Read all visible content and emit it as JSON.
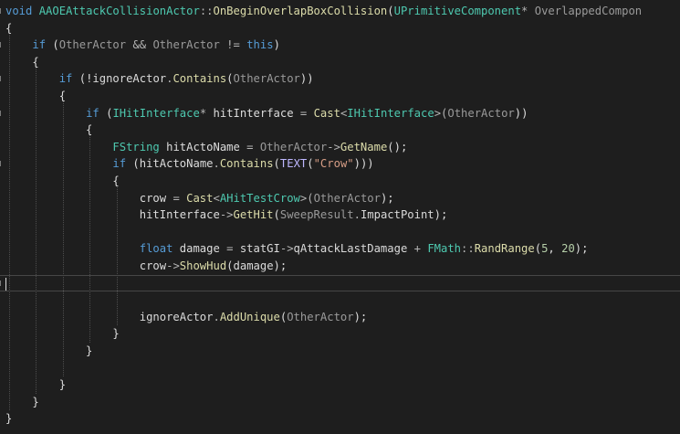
{
  "editor": {
    "language": "C++",
    "theme_colors": {
      "background": "#1e1e1e",
      "keyword": "#569cd6",
      "type": "#4ec9b0",
      "function": "#dcdcaa",
      "parameter": "#9a9a9a",
      "string": "#d69d85",
      "number": "#b5cea8",
      "macro": "#beb7ff",
      "plain": "#dcdcdc"
    },
    "cursor_line_index": 16,
    "lines": [
      {
        "tokens": [
          {
            "t": "void",
            "c": "kw"
          },
          {
            "t": " ",
            "c": "var"
          },
          {
            "t": "AAOEAttackCollisionActor",
            "c": "type"
          },
          {
            "t": "::",
            "c": "op"
          },
          {
            "t": "OnBeginOverlapBoxCollision",
            "c": "fn"
          },
          {
            "t": "(",
            "c": "var"
          },
          {
            "t": "UPrimitiveComponent",
            "c": "type"
          },
          {
            "t": "* ",
            "c": "op"
          },
          {
            "t": "OverlappedCompon",
            "c": "param"
          }
        ]
      },
      {
        "tokens": [
          {
            "t": "{",
            "c": "var"
          }
        ]
      },
      {
        "tokens": [
          {
            "t": "    ",
            "c": "var"
          },
          {
            "t": "if",
            "c": "kw"
          },
          {
            "t": " (",
            "c": "var"
          },
          {
            "t": "OtherActor",
            "c": "param"
          },
          {
            "t": " && ",
            "c": "op"
          },
          {
            "t": "OtherActor",
            "c": "param"
          },
          {
            "t": " != ",
            "c": "op"
          },
          {
            "t": "this",
            "c": "kw"
          },
          {
            "t": ")",
            "c": "var"
          }
        ]
      },
      {
        "tokens": [
          {
            "t": "    {",
            "c": "var"
          }
        ]
      },
      {
        "tokens": [
          {
            "t": "        ",
            "c": "var"
          },
          {
            "t": "if",
            "c": "kw"
          },
          {
            "t": " (!",
            "c": "var"
          },
          {
            "t": "ignoreActor",
            "c": "field"
          },
          {
            "t": ".",
            "c": "op"
          },
          {
            "t": "Contains",
            "c": "fn"
          },
          {
            "t": "(",
            "c": "var"
          },
          {
            "t": "OtherActor",
            "c": "param"
          },
          {
            "t": "))",
            "c": "var"
          }
        ]
      },
      {
        "tokens": [
          {
            "t": "        {",
            "c": "var"
          }
        ]
      },
      {
        "tokens": [
          {
            "t": "            ",
            "c": "var"
          },
          {
            "t": "if",
            "c": "kw"
          },
          {
            "t": " (",
            "c": "var"
          },
          {
            "t": "IHitInterface",
            "c": "type"
          },
          {
            "t": "* ",
            "c": "op"
          },
          {
            "t": "hitInterface",
            "c": "var"
          },
          {
            "t": " = ",
            "c": "op"
          },
          {
            "t": "Cast",
            "c": "fn"
          },
          {
            "t": "<",
            "c": "op"
          },
          {
            "t": "IHitInterface",
            "c": "type"
          },
          {
            "t": ">(",
            "c": "op"
          },
          {
            "t": "OtherActor",
            "c": "param"
          },
          {
            "t": "))",
            "c": "var"
          }
        ]
      },
      {
        "tokens": [
          {
            "t": "            {",
            "c": "var"
          }
        ]
      },
      {
        "tokens": [
          {
            "t": "                ",
            "c": "var"
          },
          {
            "t": "FString",
            "c": "type"
          },
          {
            "t": " ",
            "c": "var"
          },
          {
            "t": "hitActoName",
            "c": "var"
          },
          {
            "t": " = ",
            "c": "op"
          },
          {
            "t": "OtherActor",
            "c": "param"
          },
          {
            "t": "->",
            "c": "op"
          },
          {
            "t": "GetName",
            "c": "fn"
          },
          {
            "t": "();",
            "c": "var"
          }
        ]
      },
      {
        "tokens": [
          {
            "t": "                ",
            "c": "var"
          },
          {
            "t": "if",
            "c": "kw"
          },
          {
            "t": " (",
            "c": "var"
          },
          {
            "t": "hitActoName",
            "c": "var"
          },
          {
            "t": ".",
            "c": "op"
          },
          {
            "t": "Contains",
            "c": "fn"
          },
          {
            "t": "(",
            "c": "var"
          },
          {
            "t": "TEXT",
            "c": "mac"
          },
          {
            "t": "(",
            "c": "var"
          },
          {
            "t": "\"Crow\"",
            "c": "str"
          },
          {
            "t": ")))",
            "c": "var"
          }
        ]
      },
      {
        "tokens": [
          {
            "t": "                {",
            "c": "var"
          }
        ]
      },
      {
        "tokens": [
          {
            "t": "                    ",
            "c": "var"
          },
          {
            "t": "crow",
            "c": "var"
          },
          {
            "t": " = ",
            "c": "op"
          },
          {
            "t": "Cast",
            "c": "fn"
          },
          {
            "t": "<",
            "c": "op"
          },
          {
            "t": "AHitTestCrow",
            "c": "type"
          },
          {
            "t": ">(",
            "c": "op"
          },
          {
            "t": "OtherActor",
            "c": "param"
          },
          {
            "t": ");",
            "c": "var"
          }
        ]
      },
      {
        "tokens": [
          {
            "t": "                    ",
            "c": "var"
          },
          {
            "t": "hitInterface",
            "c": "var"
          },
          {
            "t": "->",
            "c": "op"
          },
          {
            "t": "GetHit",
            "c": "fn"
          },
          {
            "t": "(",
            "c": "var"
          },
          {
            "t": "SweepResult",
            "c": "param"
          },
          {
            "t": ".",
            "c": "op"
          },
          {
            "t": "ImpactPoint",
            "c": "field"
          },
          {
            "t": ");",
            "c": "var"
          }
        ]
      },
      {
        "tokens": []
      },
      {
        "tokens": [
          {
            "t": "                    ",
            "c": "var"
          },
          {
            "t": "float",
            "c": "kw"
          },
          {
            "t": " ",
            "c": "var"
          },
          {
            "t": "damage",
            "c": "var"
          },
          {
            "t": " = ",
            "c": "op"
          },
          {
            "t": "statGI",
            "c": "var"
          },
          {
            "t": "->",
            "c": "op"
          },
          {
            "t": "qAttackLastDamage",
            "c": "field"
          },
          {
            "t": " + ",
            "c": "op"
          },
          {
            "t": "FMath",
            "c": "type"
          },
          {
            "t": "::",
            "c": "op"
          },
          {
            "t": "RandRange",
            "c": "fn"
          },
          {
            "t": "(",
            "c": "var"
          },
          {
            "t": "5",
            "c": "num"
          },
          {
            "t": ", ",
            "c": "var"
          },
          {
            "t": "20",
            "c": "num"
          },
          {
            "t": ");",
            "c": "var"
          }
        ]
      },
      {
        "tokens": [
          {
            "t": "                    ",
            "c": "var"
          },
          {
            "t": "crow",
            "c": "var"
          },
          {
            "t": "->",
            "c": "op"
          },
          {
            "t": "ShowHud",
            "c": "fn"
          },
          {
            "t": "(",
            "c": "var"
          },
          {
            "t": "damage",
            "c": "var"
          },
          {
            "t": ");",
            "c": "var"
          }
        ]
      },
      {
        "tokens": []
      },
      {
        "tokens": []
      },
      {
        "tokens": [
          {
            "t": "                    ",
            "c": "var"
          },
          {
            "t": "ignoreActor",
            "c": "field"
          },
          {
            "t": ".",
            "c": "op"
          },
          {
            "t": "AddUnique",
            "c": "fn"
          },
          {
            "t": "(",
            "c": "var"
          },
          {
            "t": "OtherActor",
            "c": "param"
          },
          {
            "t": ");",
            "c": "var"
          }
        ]
      },
      {
        "tokens": [
          {
            "t": "                }",
            "c": "var"
          }
        ]
      },
      {
        "tokens": [
          {
            "t": "            }",
            "c": "var"
          }
        ]
      },
      {
        "tokens": []
      },
      {
        "tokens": [
          {
            "t": "        }",
            "c": "var"
          }
        ]
      },
      {
        "tokens": [
          {
            "t": "    }",
            "c": "var"
          }
        ]
      },
      {
        "tokens": [
          {
            "t": "}",
            "c": "var"
          }
        ]
      }
    ]
  }
}
